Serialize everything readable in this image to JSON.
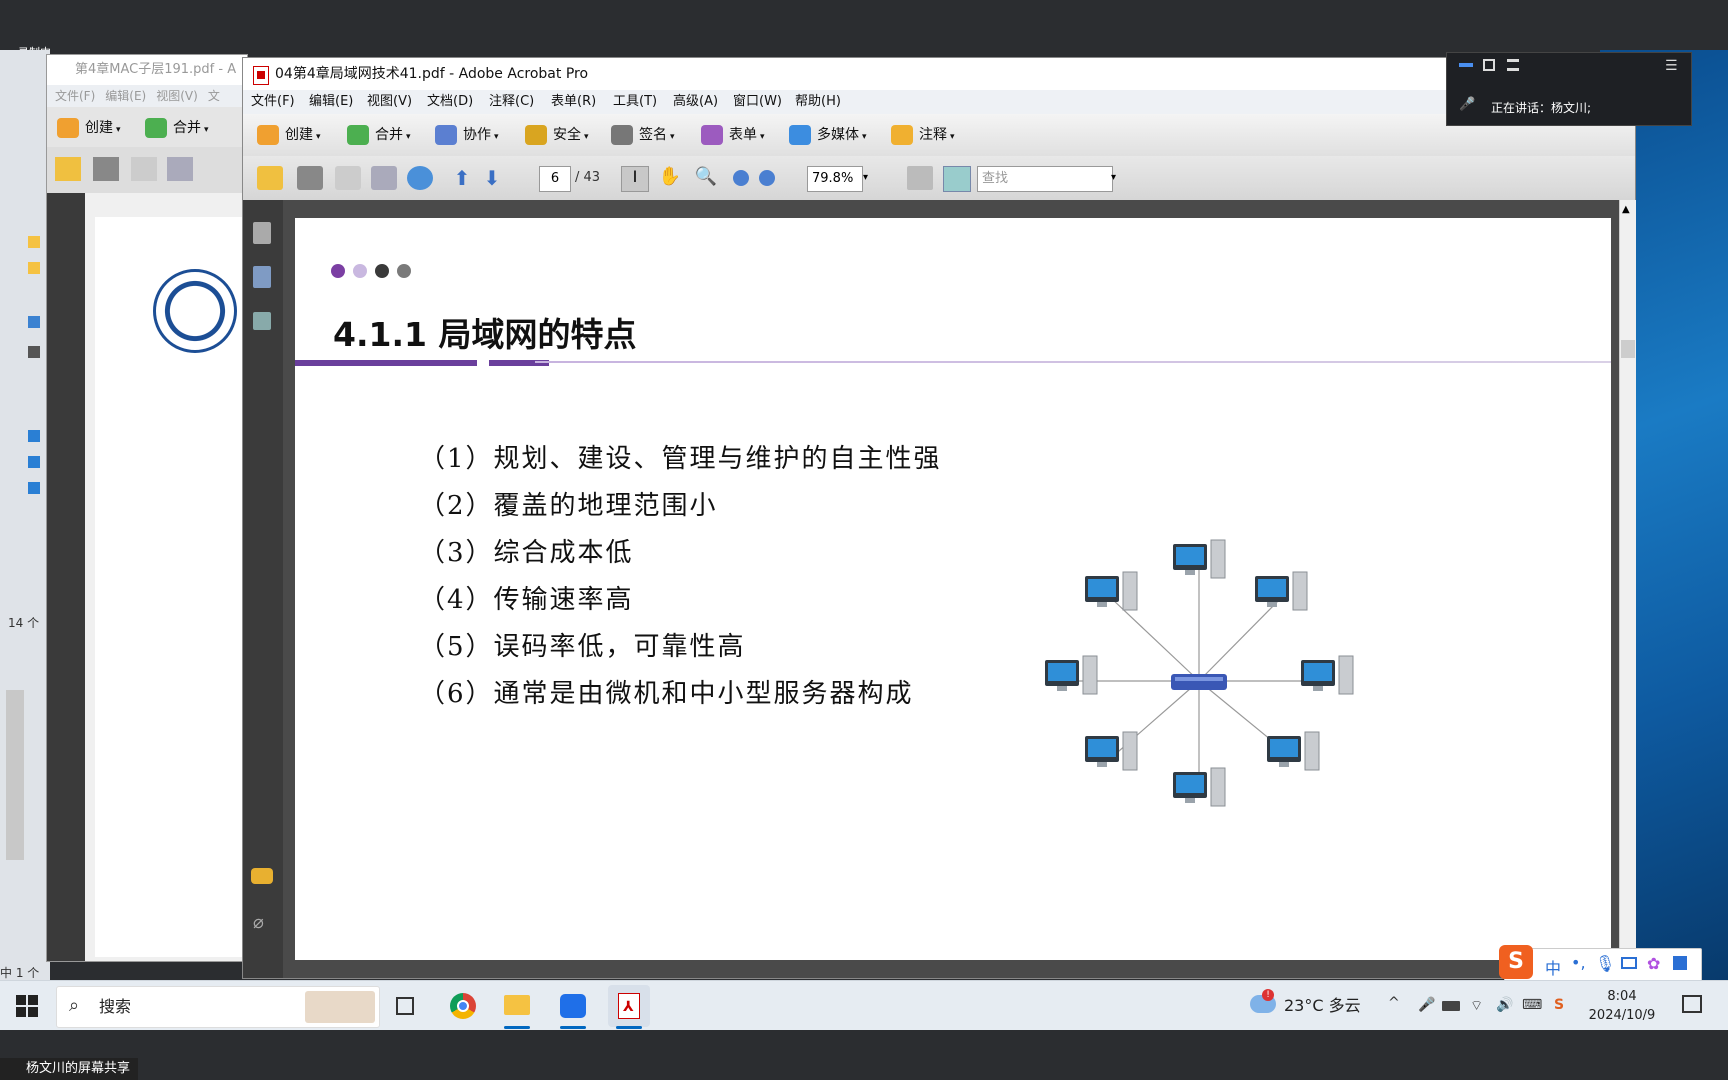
{
  "overlay": {
    "recording": "录制中"
  },
  "back_window": {
    "title": "第4章MAC子层191.pdf - A",
    "menu": [
      "文件(F)",
      "编辑(E)",
      "视图(V)",
      "文"
    ],
    "toolbar": {
      "create": "创建",
      "merge": "合并"
    }
  },
  "window": {
    "title": "04第4章局域网技术41.pdf - Adobe Acrobat Pro",
    "menu": [
      "文件(F)",
      "编辑(E)",
      "视图(V)",
      "文档(D)",
      "注释(C)",
      "表单(R)",
      "工具(T)",
      "高级(A)",
      "窗口(W)",
      "帮助(H)"
    ],
    "toolbar": {
      "create": "创建",
      "merge": "合并",
      "collaborate": "协作",
      "secure": "安全",
      "sign": "签名",
      "forms": "表单",
      "multimedia": "多媒体",
      "comment": "注释"
    },
    "nav": {
      "page": "6",
      "total": "/ 43",
      "zoom": "79.8%",
      "search_placeholder": "查找"
    }
  },
  "slide": {
    "title": "4.1.1 局域网的特点",
    "items": [
      "（1）规划、建设、管理与维护的自主性强",
      "（2）覆盖的地理范围小",
      "（3）综合成本低",
      "（4）传输速率高",
      "（5）误码率低，可靠性高",
      "（6）通常是由微机和中小型服务器构成"
    ],
    "dot_colors": [
      "#7b3fa3",
      "#c9b8e0",
      "#3a3a3a",
      "#7a7a7a"
    ],
    "accent": "#6a3f9c"
  },
  "meeting": {
    "speaking": "正在讲话：杨文川;"
  },
  "taskbar": {
    "search": "搜索",
    "weather": "23°C  多云",
    "time": "8:04",
    "date": "2024/10/9",
    "ime": "中"
  },
  "share": {
    "label": "杨文川的屏幕共享"
  },
  "left_desktop": {
    "count": "14 个",
    "count2": "中 1 个"
  }
}
